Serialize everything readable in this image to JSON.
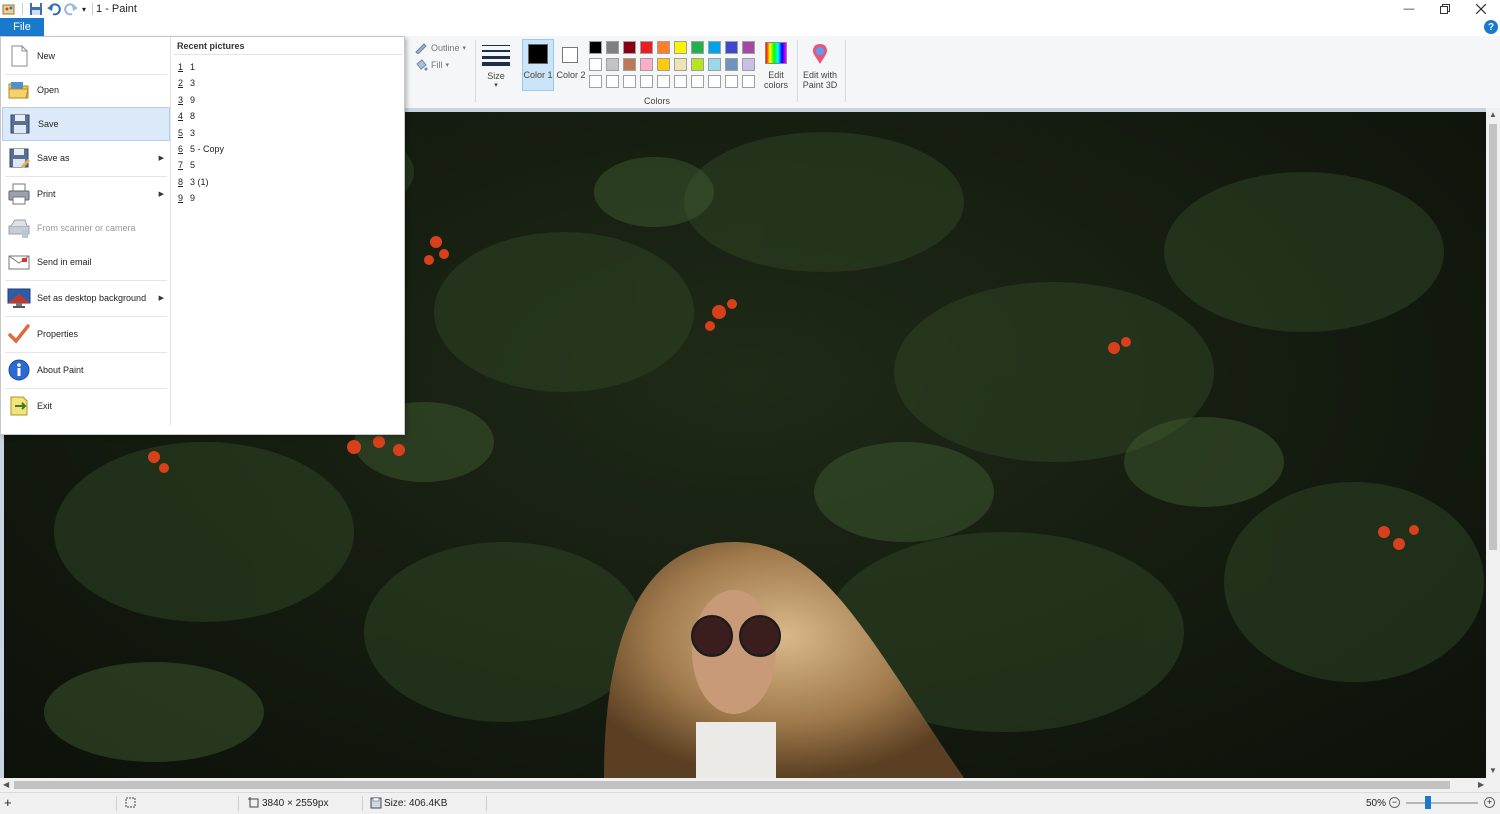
{
  "window": {
    "title": "1 - Paint",
    "file_tab": "File",
    "help_glyph": "?"
  },
  "ribbon": {
    "outline_label": "Outline",
    "fill_label": "Fill",
    "size_label": "Size",
    "color1_label": "Color 1",
    "color2_label": "Color 2",
    "colors_group_label": "Colors",
    "edit_colors_label": "Edit colors",
    "paint3d_label": "Edit with Paint 3D",
    "color1_value": "#000000",
    "color2_value": "#ffffff",
    "palette_row1": [
      "#000000",
      "#7f7f7f",
      "#880015",
      "#ed1c24",
      "#ff7f27",
      "#fff200",
      "#22b14c",
      "#00a2e8",
      "#3f48cc",
      "#a349a4"
    ],
    "palette_row2": [
      "#ffffff",
      "#c3c3c3",
      "#b97a57",
      "#ffaec9",
      "#ffc90e",
      "#efe4b0",
      "#b5e61d",
      "#99d9ea",
      "#7092be",
      "#c8bfe7"
    ],
    "palette_row3": [
      "#ffffff",
      "#ffffff",
      "#ffffff",
      "#ffffff",
      "#ffffff",
      "#ffffff",
      "#ffffff",
      "#ffffff",
      "#ffffff",
      "#ffffff"
    ]
  },
  "file_menu": {
    "items": [
      {
        "label": "New",
        "icon": "new-file-icon"
      },
      {
        "label": "Open",
        "icon": "open-folder-icon"
      },
      {
        "label": "Save",
        "icon": "save-icon"
      },
      {
        "label": "Save as",
        "icon": "save-as-icon"
      },
      {
        "label": "Print",
        "icon": "printer-icon"
      },
      {
        "label": "From scanner or camera",
        "icon": "scanner-icon"
      },
      {
        "label": "Send in email",
        "icon": "email-icon"
      },
      {
        "label": "Set as desktop background",
        "icon": "desktop-icon"
      },
      {
        "label": "Properties",
        "icon": "checkmark-icon"
      },
      {
        "label": "About Paint",
        "icon": "info-icon"
      },
      {
        "label": "Exit",
        "icon": "exit-icon"
      }
    ],
    "recent_title": "Recent pictures",
    "recent": [
      {
        "num": "1",
        "name": "1"
      },
      {
        "num": "2",
        "name": "3"
      },
      {
        "num": "3",
        "name": "9"
      },
      {
        "num": "4",
        "name": "8"
      },
      {
        "num": "5",
        "name": "3"
      },
      {
        "num": "6",
        "name": "5 - Copy"
      },
      {
        "num": "7",
        "name": "5"
      },
      {
        "num": "8",
        "name": "3 (1)"
      },
      {
        "num": "9",
        "name": "9"
      }
    ]
  },
  "status": {
    "dimensions": "3840 × 2559px",
    "size": "Size: 406.4KB",
    "zoom": "50%",
    "zoom_level_fraction": 0.3
  }
}
